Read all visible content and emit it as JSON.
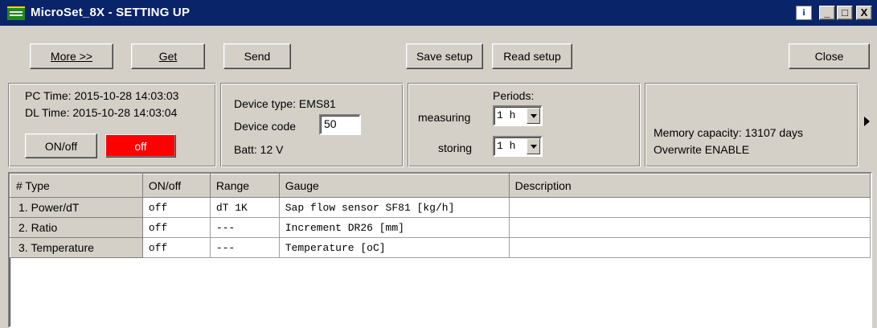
{
  "window": {
    "title": "MicroSet_8X - SETTING UP",
    "controls": {
      "info": "i",
      "minimize": "_",
      "maximize": "□",
      "close": "X"
    }
  },
  "toolbar": {
    "more": "More >>",
    "get": "Get",
    "send": "Send",
    "save_setup": "Save setup",
    "read_setup": "Read setup",
    "close": "Close"
  },
  "time_panel": {
    "pc_time": "PC Time: 2015-10-28 14:03:03",
    "dl_time": "DL Time: 2015-10-28 14:03:04",
    "onoff_button": "ON/off",
    "state_button": "off"
  },
  "device_panel": {
    "device_type": "Device type: EMS81",
    "device_code_label": "Device code",
    "device_code_value": "50",
    "batt": "Batt: 12 V"
  },
  "periods_panel": {
    "title": "Periods:",
    "measuring_label": "measuring",
    "measuring_value": "1 h",
    "storing_label": "storing",
    "storing_value": "1 h"
  },
  "memory_panel": {
    "capacity": "Memory capacity: 13107 days",
    "overwrite": "Overwrite ENABLE"
  },
  "grid": {
    "headers": [
      "# Type",
      "ON/off",
      "Range",
      "Gauge",
      "Description"
    ],
    "rows": [
      {
        "type": "1. Power/dT",
        "onoff": "off",
        "range": "dT 1K",
        "gauge": "Sap flow sensor SF81 [kg/h]",
        "description": ""
      },
      {
        "type": "2. Ratio",
        "onoff": "off",
        "range": "---",
        "gauge": "Increment DR26 [mm]",
        "description": ""
      },
      {
        "type": "3. Temperature",
        "onoff": "off",
        "range": "---",
        "gauge": "Temperature [oC]",
        "description": ""
      }
    ]
  },
  "colors": {
    "titlebar": "#0a246a",
    "off_state": "#ff0000",
    "face": "#d4d0c8"
  }
}
